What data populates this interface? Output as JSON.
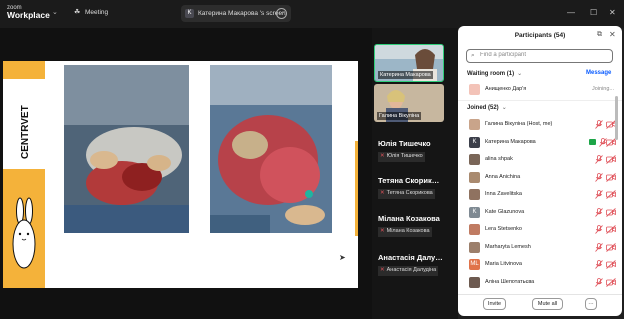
{
  "app": {
    "logo_top": "zoom",
    "logo_bottom": "Workplace"
  },
  "titlebar": {
    "meeting_label": "Meeting",
    "share_tab_badge": "K",
    "share_tab_label": "Катерина Макарова 's screen"
  },
  "slide": {
    "brand": "CENTRVET"
  },
  "gallery": {
    "tiles": [
      {
        "name": "Катерина Макарова"
      },
      {
        "name": "Галина Вікуліна"
      }
    ],
    "names": [
      {
        "title": "Юлія Тишечко",
        "sub": "Юлія Тишечко"
      },
      {
        "title": "Тетяна Скорик…",
        "sub": "Тетяна Скорикова"
      },
      {
        "title": "Мілана Козакова",
        "sub": "Мілана Козакова"
      },
      {
        "title": "Анастасія Далу…",
        "sub": "Анастасія Далудіна"
      }
    ]
  },
  "participants": {
    "title": "Participants (54)",
    "search_placeholder": "Find a participant",
    "waiting_room_label": "Waiting room (1)",
    "message_label": "Message",
    "waiting": [
      {
        "name": "Анищенко Дар'я",
        "status": "Joining...",
        "avatar_color": "#f3c3b8"
      }
    ],
    "joined_label": "Joined (52)",
    "joined": [
      {
        "name": "Галина Вікуліна (Host, me)",
        "initial": "",
        "avatar_color": "#c9a48a",
        "share": false
      },
      {
        "name": "Катерина Макарова",
        "initial": "K",
        "avatar_color": "#3c3f4a",
        "share": true
      },
      {
        "name": "alina shpak",
        "initial": "",
        "avatar_color": "#7a6658",
        "share": false
      },
      {
        "name": "Anna Anichina",
        "initial": "",
        "avatar_color": "#a98a6f",
        "share": false
      },
      {
        "name": "Inna Zavelitska",
        "initial": "",
        "avatar_color": "#8f7260",
        "share": false
      },
      {
        "name": "Kate Glazunova",
        "initial": "K",
        "avatar_color": "#7f8a93",
        "share": false
      },
      {
        "name": "Lera Stetsenko",
        "initial": "",
        "avatar_color": "#c07b62",
        "share": false
      },
      {
        "name": "Marharyta Lemesh",
        "initial": "",
        "avatar_color": "#9c7f6b",
        "share": false
      },
      {
        "name": "Maria Litvinova",
        "initial": "ML",
        "avatar_color": "#e0734a",
        "share": false
      },
      {
        "name": "Аліна Шепотатьєва",
        "initial": "",
        "avatar_color": "#6d5a50",
        "share": false
      }
    ],
    "invite_label": "Invite",
    "mute_all_label": "Mute all",
    "more_label": "···"
  }
}
